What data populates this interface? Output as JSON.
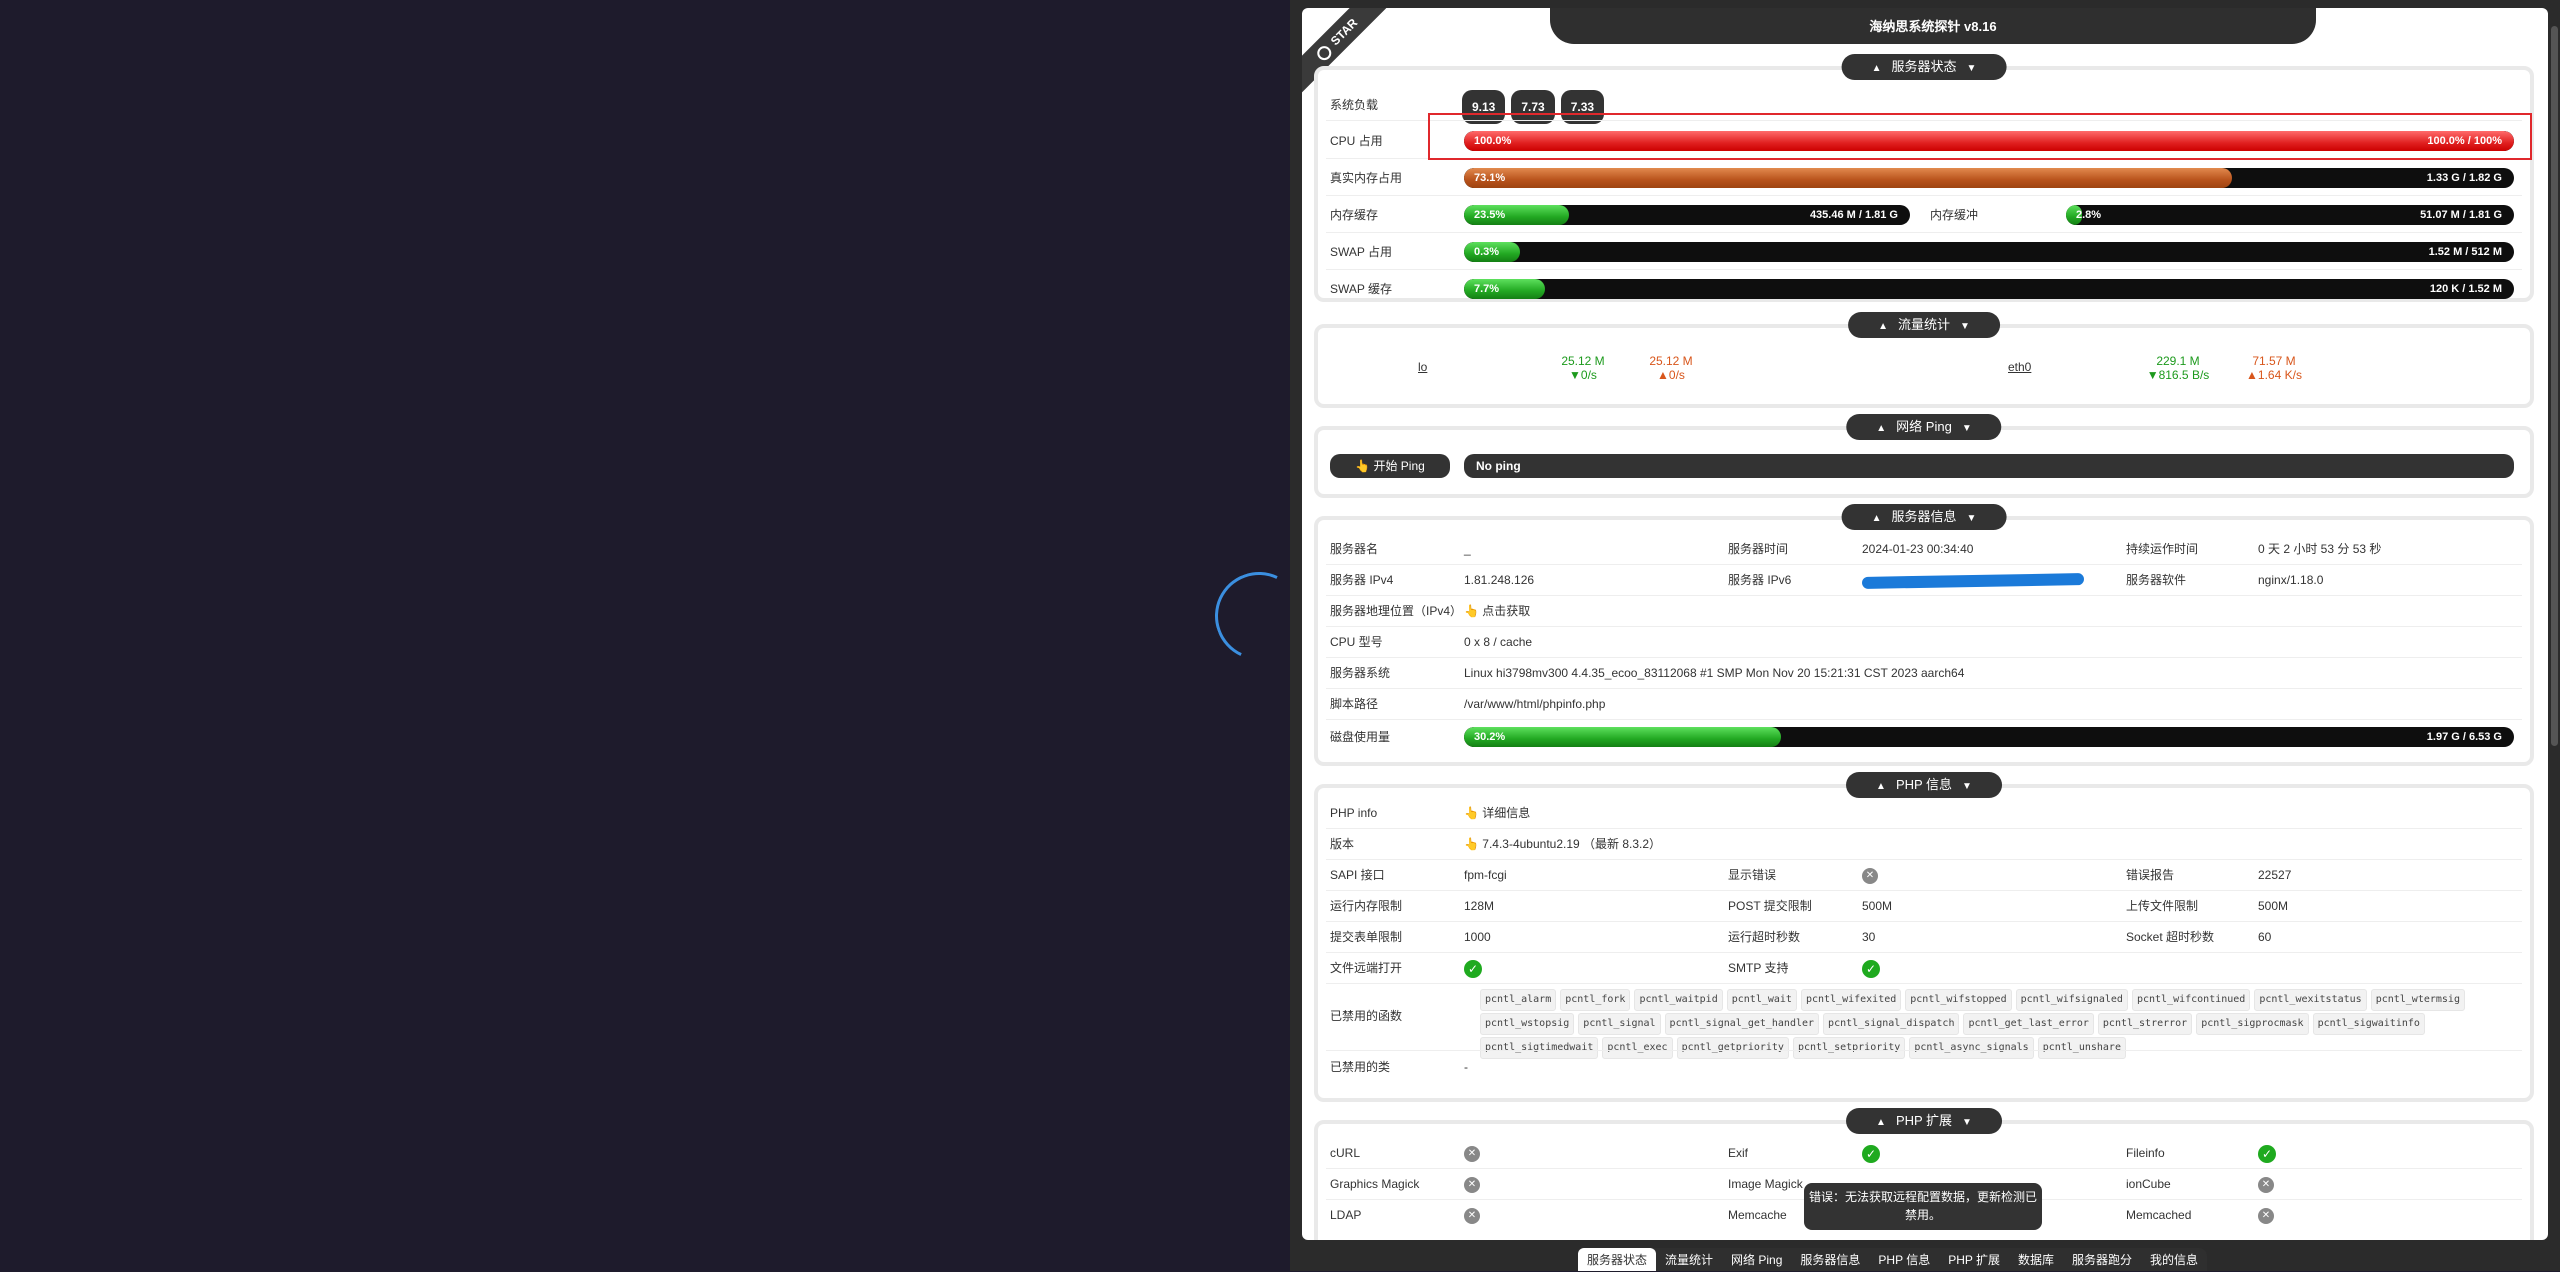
{
  "page_title": "海纳思系统探针 v8.16",
  "ribbon": "STAR",
  "server_status": {
    "header": "服务器状态",
    "load_label": "系统负载",
    "loads": [
      "9.13",
      "7.73",
      "7.33"
    ],
    "cpu": {
      "label": "CPU 占用",
      "pct_text": "100.0%",
      "amount": "100.0% / 100%",
      "fraction": 1.0
    },
    "real_mem": {
      "label": "真实内存占用",
      "pct_text": "73.1%",
      "amount": "1.33 G / 1.82 G",
      "fraction": 0.731
    },
    "mem_cache": {
      "label": "内存缓存",
      "pct_text": "23.5%",
      "amount": "435.46 M / 1.81 G",
      "fraction": 0.235
    },
    "mem_buffer": {
      "label": "内存缓冲",
      "pct_text": "2.8%",
      "amount": "51.07 M / 1.81 G",
      "fraction": 0.028
    },
    "swap_used": {
      "label": "SWAP 占用",
      "pct_text": "0.3%",
      "amount": "1.52 M / 512 M",
      "fraction": 0.003
    },
    "swap_cache": {
      "label": "SWAP 缓存",
      "pct_text": "7.7%",
      "amount": "120 K / 1.52 M",
      "fraction": 0.077
    }
  },
  "traffic": {
    "header": "流量统计",
    "ifaces": [
      {
        "name": "lo",
        "rx_total": "25.12 M",
        "rx_rate": "▼0/s",
        "tx_total": "25.12 M",
        "tx_rate": "▲0/s"
      },
      {
        "name": "eth0",
        "rx_total": "229.1 M",
        "rx_rate": "▼816.5 B/s",
        "tx_total": "71.57 M",
        "tx_rate": "▲1.64 K/s"
      }
    ]
  },
  "ping": {
    "header": "网络 Ping",
    "button": "👆 开始 Ping",
    "result": "No ping"
  },
  "server_info": {
    "header": "服务器信息",
    "name_label": "服务器名",
    "name": "_",
    "time_label": "服务器时间",
    "time": "2024-01-23 00:34:40",
    "uptime_label": "持续运作时间",
    "uptime": "0 天 2 小时 53 分 53 秒",
    "ipv4_label": "服务器 IPv4",
    "ipv4": "1.81.248.126",
    "ipv6_label": "服务器 IPv6",
    "software_label": "服务器软件",
    "software": "nginx/1.18.0",
    "geo_label": "服务器地理位置（IPv4）",
    "geo": "👆 点击获取",
    "cpu_label": "CPU 型号",
    "cpu": "0 x 8 / cache",
    "os_label": "服务器系统",
    "os": "Linux hi3798mv300 4.4.35_ecoo_83112068 #1 SMP Mon Nov 20 15:21:31 CST 2023 aarch64",
    "path_label": "脚本路径",
    "path": "/var/www/html/phpinfo.php",
    "disk": {
      "label": "磁盘使用量",
      "pct_text": "30.2%",
      "amount": "1.97 G / 6.53 G",
      "fraction": 0.302
    }
  },
  "php_info": {
    "header": "PHP 信息",
    "phpinfo_label": "PHP info",
    "phpinfo": "👆 详细信息",
    "version_label": "版本",
    "version": "👆 7.4.3-4ubuntu2.19 （最新 8.3.2）",
    "sapi_label": "SAPI 接口",
    "sapi": "fpm-fcgi",
    "display_errors_label": "显示错误",
    "error_report_label": "错误报告",
    "error_report": "22527",
    "mem_limit_label": "运行内存限制",
    "mem_limit": "128M",
    "post_limit_label": "POST 提交限制",
    "post_limit": "500M",
    "upload_limit_label": "上传文件限制",
    "upload_limit": "500M",
    "form_limit_label": "提交表单限制",
    "form_limit": "1000",
    "timeout_label": "运行超时秒数",
    "timeout": "30",
    "socket_label": "Socket 超时秒数",
    "socket": "60",
    "remote_label": "文件远端打开",
    "smtp_label": "SMTP 支持",
    "disabled_funcs_label": "已禁用的函数",
    "disabled_funcs": [
      "pcntl_alarm",
      "pcntl_fork",
      "pcntl_waitpid",
      "pcntl_wait",
      "pcntl_wifexited",
      "pcntl_wifstopped",
      "pcntl_wifsignaled",
      "pcntl_wifcontinued",
      "pcntl_wexitstatus",
      "pcntl_wtermsig",
      "pcntl_wstopsig",
      "pcntl_signal",
      "pcntl_signal_get_handler",
      "pcntl_signal_dispatch",
      "pcntl_get_last_error",
      "pcntl_strerror",
      "pcntl_sigprocmask",
      "pcntl_sigwaitinfo",
      "pcntl_sigtimedwait",
      "pcntl_exec",
      "pcntl_getpriority",
      "pcntl_setpriority",
      "pcntl_async_signals",
      "pcntl_unshare"
    ],
    "disabled_classes_label": "已禁用的类",
    "disabled_classes": "-"
  },
  "php_ext": {
    "header": "PHP 扩展",
    "curl": "cURL",
    "exif": "Exif",
    "fileinfo": "Fileinfo",
    "gmagick": "Graphics Magick",
    "imagick": "Image Magick",
    "ioncube": "ionCube",
    "ldap": "LDAP",
    "memcache": "Memcache",
    "memcached": "Memcached"
  },
  "toast": "错误：无法获取远程配置数据，更新检测已禁用。",
  "bottom_nav": [
    "服务器状态",
    "流量统计",
    "网络 Ping",
    "服务器信息",
    "PHP 信息",
    "PHP 扩展",
    "数据库",
    "服务器跑分",
    "我的信息"
  ],
  "icons": {
    "ok": "check-icon",
    "no": "cross-icon"
  }
}
